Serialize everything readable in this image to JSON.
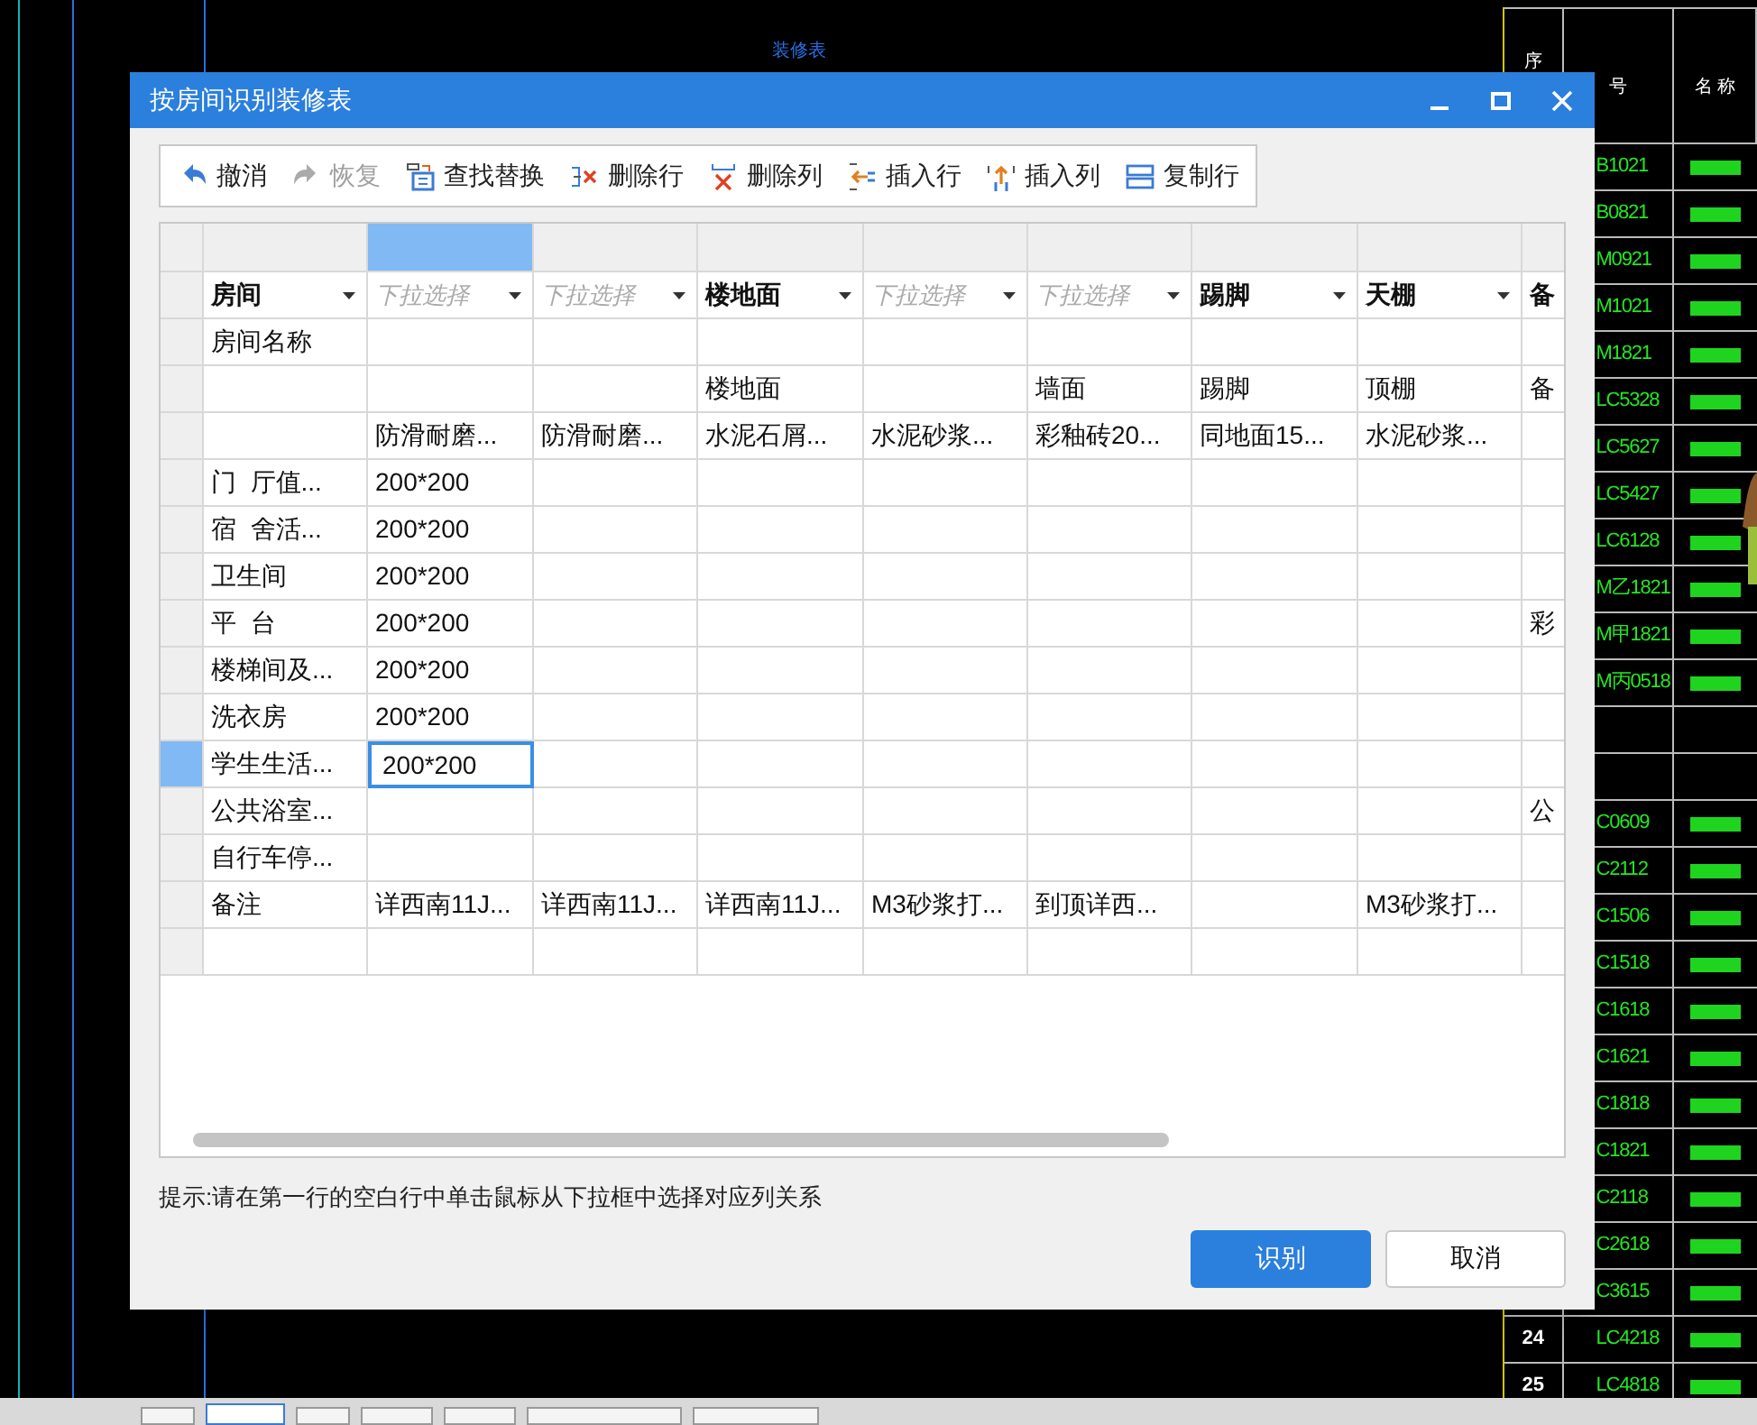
{
  "drawing": {
    "title": "装修表",
    "table": {
      "headers": [
        "序",
        "号",
        "名 称"
      ],
      "rows": [
        {
          "kind": "entry",
          "code": "B1021"
        },
        {
          "kind": "entry",
          "code": "B0821"
        },
        {
          "kind": "entry",
          "code": "M0921"
        },
        {
          "kind": "entry",
          "code": "M1021"
        },
        {
          "kind": "entry",
          "code": "M1821"
        },
        {
          "kind": "entry",
          "code": "LC5328"
        },
        {
          "kind": "entry",
          "code": "LC5627"
        },
        {
          "kind": "entry",
          "code": "LC5427"
        },
        {
          "kind": "entry",
          "code": "LC6128"
        },
        {
          "kind": "entry",
          "code": "M乙1821"
        },
        {
          "kind": "entry",
          "code": "M甲1821"
        },
        {
          "kind": "entry",
          "code": "M丙0518"
        },
        {
          "kind": "blank"
        },
        {
          "kind": "blank"
        },
        {
          "kind": "entry",
          "code": "C0609"
        },
        {
          "kind": "entry",
          "code": "C2112"
        },
        {
          "kind": "entry",
          "code": "C1506"
        },
        {
          "kind": "entry",
          "code": "C1518"
        },
        {
          "kind": "entry",
          "code": "C1618"
        },
        {
          "kind": "entry",
          "code": "C1621"
        },
        {
          "kind": "entry",
          "code": "C1818"
        },
        {
          "kind": "entry",
          "code": "C1821"
        },
        {
          "kind": "entry",
          "code": "C2118"
        },
        {
          "kind": "entry",
          "code": "C2618"
        },
        {
          "kind": "entry",
          "code": "C3615"
        },
        {
          "kind": "entry",
          "number": "24",
          "code": "LC4218"
        },
        {
          "kind": "entry",
          "number": "25",
          "code": "LC4818"
        }
      ]
    }
  },
  "dialog": {
    "title": "按房间识别装修表",
    "toolbar": [
      {
        "label": "撤消",
        "disabled": false
      },
      {
        "label": "恢复",
        "disabled": true
      },
      {
        "label": "查找替换",
        "disabled": false
      },
      {
        "label": "删除行",
        "disabled": false
      },
      {
        "label": "删除列",
        "disabled": false
      },
      {
        "label": "插入行",
        "disabled": false
      },
      {
        "label": "插入列",
        "disabled": false
      },
      {
        "label": "复制行",
        "disabled": false
      }
    ],
    "table": {
      "columns": [
        {
          "selected": false,
          "kind": "value",
          "header": "房间"
        },
        {
          "selected": true,
          "kind": "placeholder",
          "header": "下拉选择"
        },
        {
          "selected": false,
          "kind": "placeholder",
          "header": "下拉选择"
        },
        {
          "selected": false,
          "kind": "value",
          "header": "楼地面"
        },
        {
          "selected": false,
          "kind": "placeholder",
          "header": "下拉选择"
        },
        {
          "selected": false,
          "kind": "placeholder",
          "header": "下拉选择"
        },
        {
          "selected": false,
          "kind": "value",
          "header": "踢脚"
        },
        {
          "selected": false,
          "kind": "value",
          "header": "天棚"
        },
        {
          "selected": false,
          "kind": "cut",
          "header": "备"
        }
      ],
      "rows": [
        {
          "selected": false,
          "cells": {
            "c0": "房间名称"
          }
        },
        {
          "selected": false,
          "cells": {
            "c3": "楼地面",
            "c5": "墙面",
            "c6": "踢脚",
            "c7": "顶棚",
            "c8": "备"
          }
        },
        {
          "selected": false,
          "cells": {
            "c1": "防滑耐磨...",
            "c2": "防滑耐磨...",
            "c3": "水泥石屑...",
            "c4": "水泥砂浆...",
            "c5": "彩釉砖20...",
            "c6": "同地面15...",
            "c7": "水泥砂浆..."
          }
        },
        {
          "selected": false,
          "cells": {
            "c0": "门  厅值...",
            "c1": "200*200"
          }
        },
        {
          "selected": false,
          "cells": {
            "c0": "宿  舍活...",
            "c1": "200*200"
          }
        },
        {
          "selected": false,
          "cells": {
            "c0": "卫生间",
            "c1": "200*200"
          }
        },
        {
          "selected": false,
          "cells": {
            "c0": "平  台",
            "c1": "200*200",
            "c8": "彩"
          }
        },
        {
          "selected": false,
          "cells": {
            "c0": "楼梯间及...",
            "c1": "200*200"
          }
        },
        {
          "selected": false,
          "cells": {
            "c0": "洗衣房",
            "c1": "200*200"
          }
        },
        {
          "selected": true,
          "cells": {
            "c0": "学生生活...",
            "c1": "200*200"
          }
        },
        {
          "selected": false,
          "cells": {
            "c0": "公共浴室...",
            "c8": "公"
          }
        },
        {
          "selected": false,
          "cells": {
            "c0": "自行车停..."
          }
        },
        {
          "selected": false,
          "cells": {
            "c0": "备注",
            "c1": "详西南11J...",
            "c2": "详西南11J...",
            "c3": "详西南11J...",
            "c4": "M3砂浆打...",
            "c5": "到顶详西...",
            "c7": "M3砂浆打..."
          }
        },
        {
          "selected": false,
          "cells": {}
        }
      ]
    },
    "hint": "提示:请在第一行的空白行中单击鼠标从下拉框中选择对应列关系",
    "buttons": [
      {
        "label": "识别",
        "kind": "primary"
      },
      {
        "label": "取消",
        "kind": "secondary"
      }
    ]
  }
}
